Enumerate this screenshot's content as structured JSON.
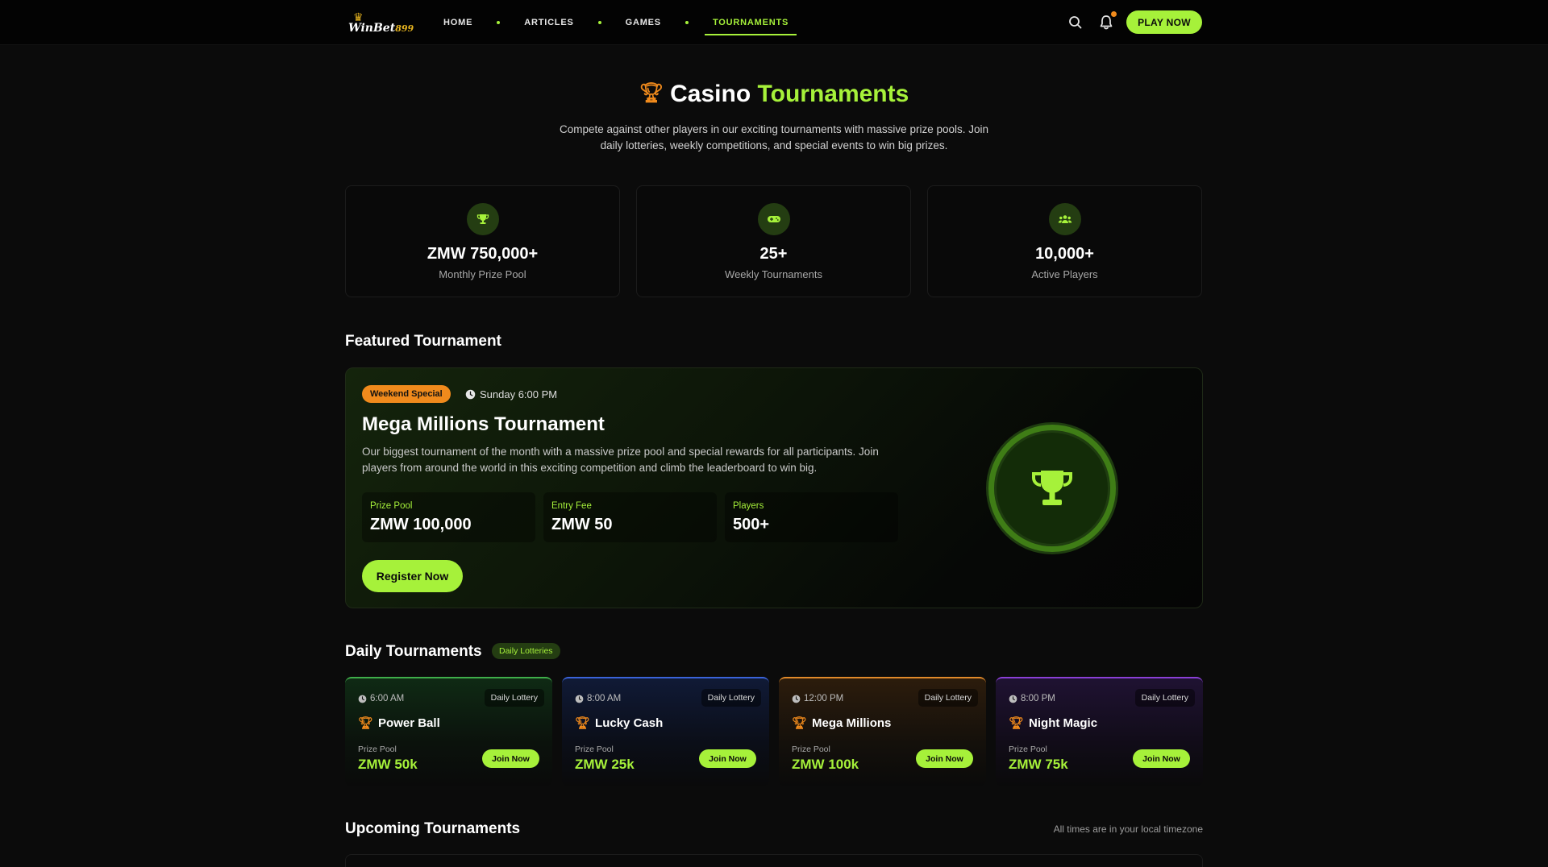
{
  "brand": {
    "name": "WinBet",
    "suffix": "899"
  },
  "nav": {
    "items": [
      {
        "label": "HOME"
      },
      {
        "label": "ARTICLES"
      },
      {
        "label": "GAMES"
      },
      {
        "label": "TOURNAMENTS",
        "active": true
      }
    ],
    "play_label": "PLAY NOW"
  },
  "hero": {
    "title_main": "Casino",
    "title_accent": "Tournaments",
    "description": "Compete against other players in our exciting tournaments with massive prize pools. Join daily lotteries, weekly competitions, and special events to win big prizes."
  },
  "stats": [
    {
      "icon": "trophy-icon",
      "value": "ZMW 750,000+",
      "label": "Monthly Prize Pool"
    },
    {
      "icon": "gamepad-icon",
      "value": "25+",
      "label": "Weekly Tournaments"
    },
    {
      "icon": "users-icon",
      "value": "10,000+",
      "label": "Active Players"
    }
  ],
  "featured": {
    "section_title": "Featured Tournament",
    "badge": "Weekend Special",
    "time": "Sunday 6:00 PM",
    "title": "Mega Millions Tournament",
    "description": "Our biggest tournament of the month with a massive prize pool and special rewards for all participants. Join players from around the world in this exciting competition and climb the leaderboard to win big.",
    "details": [
      {
        "label": "Prize Pool",
        "value": "ZMW 100,000"
      },
      {
        "label": "Entry Fee",
        "value": "ZMW 50"
      },
      {
        "label": "Players",
        "value": "500+"
      }
    ],
    "register_label": "Register Now"
  },
  "daily": {
    "section_title": "Daily Tournaments",
    "badge": "Daily Lotteries",
    "prize_label": "Prize Pool",
    "join_label": "Join Now",
    "cards": [
      {
        "time": "6:00 AM",
        "type": "Daily Lottery",
        "name": "Power Ball",
        "prize": "ZMW 50k",
        "accent": "#3fae4a"
      },
      {
        "time": "8:00 AM",
        "type": "Daily Lottery",
        "name": "Lucky Cash",
        "prize": "ZMW 25k",
        "accent": "#3a63d9"
      },
      {
        "time": "12:00 PM",
        "type": "Daily Lottery",
        "name": "Mega Millions",
        "prize": "ZMW 100k",
        "accent": "#e0892a"
      },
      {
        "time": "8:00 PM",
        "type": "Daily Lottery",
        "name": "Night Magic",
        "prize": "ZMW 75k",
        "accent": "#8a3fd6"
      }
    ]
  },
  "upcoming": {
    "section_title": "Upcoming Tournaments",
    "timezone_note": "All times are in your local timezone"
  },
  "colors": {
    "accent": "#a6f13a",
    "orange": "#f08a1c",
    "background": "#0b0b0b"
  }
}
